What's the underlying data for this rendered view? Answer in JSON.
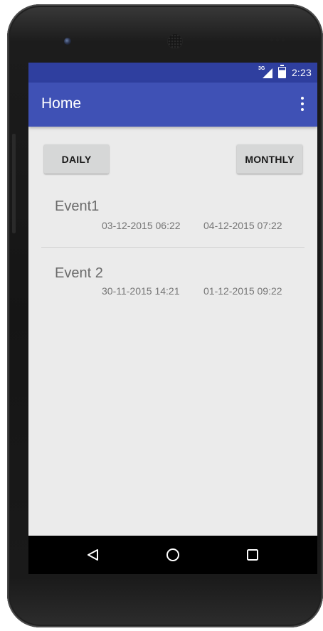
{
  "status_bar": {
    "network": "3G",
    "time": "2:23"
  },
  "app_bar": {
    "title": "Home",
    "overflow_icon": "more-vert-icon"
  },
  "buttons": {
    "daily": "DAILY",
    "monthly": "MONTHLY"
  },
  "events": [
    {
      "name": "Event1",
      "start": "03-12-2015 06:22",
      "end": "04-12-2015 07:22"
    },
    {
      "name": "Event 2",
      "start": "30-11-2015 14:21",
      "end": "01-12-2015 09:22"
    }
  ],
  "nav_bar": {
    "icons": [
      "back-icon",
      "home-icon",
      "recents-icon"
    ]
  },
  "colors": {
    "status_bar": "#2f3f9f",
    "app_bar": "#3f51b5",
    "screen_background": "#ebebeb",
    "button": "#d6d7d7"
  }
}
